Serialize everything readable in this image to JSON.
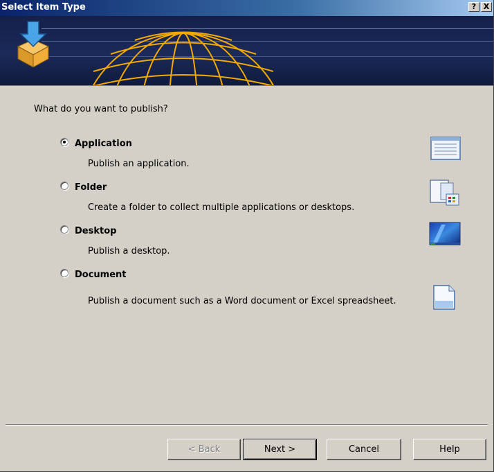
{
  "window": {
    "title": "Select Item Type",
    "help_button": "?",
    "close_button": "X"
  },
  "prompt": "What do you want to publish?",
  "options": [
    {
      "label": "Application",
      "description": "Publish an application.",
      "selected": true,
      "icon": "application-window-icon"
    },
    {
      "label": "Folder",
      "description": "Create a folder to collect multiple applications or desktops.",
      "selected": false,
      "icon": "folder-document-icon"
    },
    {
      "label": "Desktop",
      "description": "Publish a desktop.",
      "selected": false,
      "icon": "desktop-screen-icon"
    },
    {
      "label": "Document",
      "description": "Publish a document such as a Word document or Excel spreadsheet.",
      "selected": false,
      "icon": "document-page-icon"
    }
  ],
  "buttons": {
    "back": "< Back",
    "next": "Next >",
    "cancel": "Cancel",
    "help": "Help"
  },
  "colors": {
    "dialog_bg": "#d4d0c8",
    "titlebar_start": "#0a246a",
    "banner_bg": "#1b2a5a",
    "globe": "#f2a900"
  }
}
